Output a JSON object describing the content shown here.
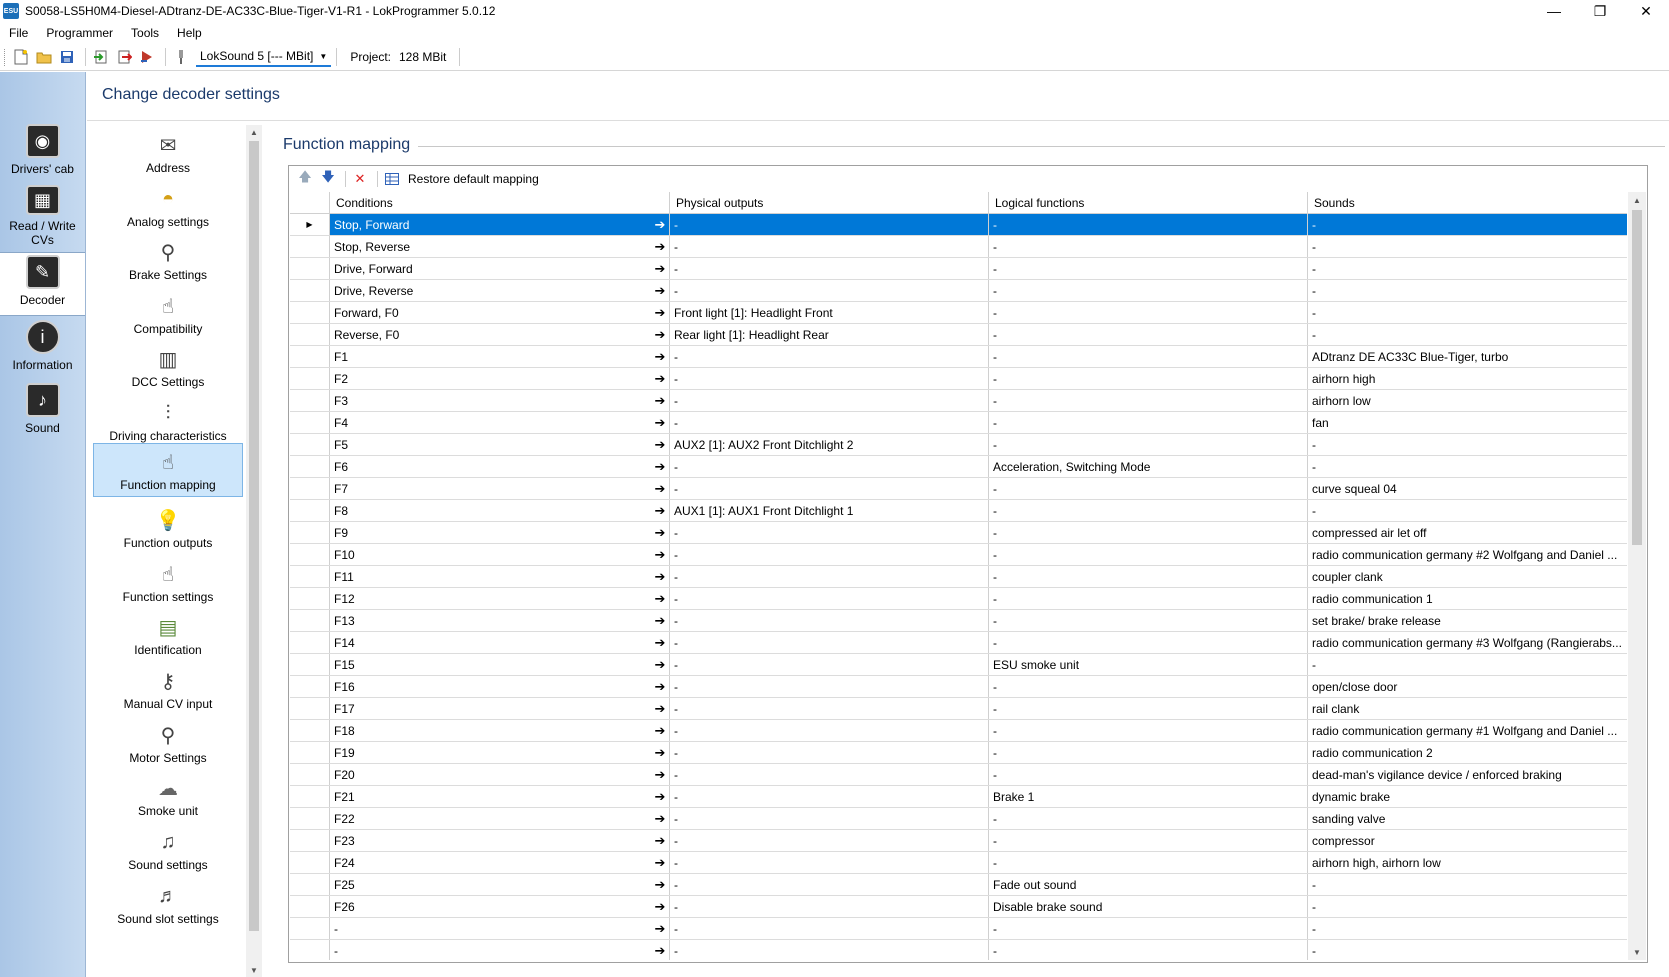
{
  "window": {
    "title": "S0058-LS5H0M4-Diesel-ADtranz-DE-AC33C-Blue-Tiger-V1-R1 - LokProgrammer 5.0.12",
    "app_icon": "ESU",
    "minimize": "—",
    "restore": "❐",
    "close": "✕"
  },
  "menu": [
    "File",
    "Programmer",
    "Tools",
    "Help"
  ],
  "toolbar": {
    "decoder_combo": "LokSound 5 [--- MBit]",
    "project_label": "Project:",
    "project_value": "128 MBit",
    "icons": [
      "new-file-icon",
      "open-folder-icon",
      "save-icon",
      "import-icon",
      "export-icon",
      "play-sound-icon",
      "usb-icon"
    ]
  },
  "rail": [
    {
      "label": "Drivers' cab",
      "icon": "◉"
    },
    {
      "label": "Read / Write CVs",
      "icon": "▦"
    },
    {
      "label": "Decoder",
      "icon": "✎"
    },
    {
      "label": "Information",
      "icon": "i"
    },
    {
      "label": "Sound",
      "icon": "♪"
    }
  ],
  "page_title": "Change decoder settings",
  "categories": [
    {
      "label": "Address",
      "icon": "✉"
    },
    {
      "label": "Analog settings",
      "icon": "◓"
    },
    {
      "label": "Brake Settings",
      "icon": "⚲"
    },
    {
      "label": "Compatibility",
      "icon": "☝"
    },
    {
      "label": "DCC Settings",
      "icon": "▥"
    },
    {
      "label": "Driving characteristics",
      "icon": "⫶"
    },
    {
      "label": "Function mapping",
      "icon": "☝"
    },
    {
      "label": "Function outputs",
      "icon": "💡"
    },
    {
      "label": "Function settings",
      "icon": "☝"
    },
    {
      "label": "Identification",
      "icon": "▤"
    },
    {
      "label": "Manual CV input",
      "icon": "⚷"
    },
    {
      "label": "Motor Settings",
      "icon": "⚲"
    },
    {
      "label": "Smoke unit",
      "icon": "☁"
    },
    {
      "label": "Sound settings",
      "icon": "♫"
    },
    {
      "label": "Sound slot settings",
      "icon": "♬"
    }
  ],
  "section_title": "Function mapping",
  "grid_toolbar": {
    "restore_label": "Restore default mapping"
  },
  "columns": [
    "Conditions",
    "Physical outputs",
    "Logical functions",
    "Sounds"
  ],
  "rows": [
    {
      "cond": "Stop, Forward",
      "phys": "-",
      "log": "-",
      "snd": "-"
    },
    {
      "cond": "Stop, Reverse",
      "phys": "-",
      "log": "-",
      "snd": "-"
    },
    {
      "cond": "Drive, Forward",
      "phys": "-",
      "log": "-",
      "snd": "-"
    },
    {
      "cond": "Drive, Reverse",
      "phys": "-",
      "log": "-",
      "snd": "-"
    },
    {
      "cond": "Forward, F0",
      "phys": "Front light [1]: Headlight Front",
      "log": "-",
      "snd": "-"
    },
    {
      "cond": "Reverse, F0",
      "phys": "Rear light [1]: Headlight Rear",
      "log": "-",
      "snd": "-"
    },
    {
      "cond": "F1",
      "phys": "-",
      "log": "-",
      "snd": "ADtranz DE AC33C Blue-Tiger, turbo"
    },
    {
      "cond": "F2",
      "phys": "-",
      "log": "-",
      "snd": "airhorn high"
    },
    {
      "cond": "F3",
      "phys": "-",
      "log": "-",
      "snd": "airhorn low"
    },
    {
      "cond": "F4",
      "phys": "-",
      "log": "-",
      "snd": "fan"
    },
    {
      "cond": "F5",
      "phys": "AUX2 [1]: AUX2 Front Ditchlight 2",
      "log": "-",
      "snd": "-"
    },
    {
      "cond": "F6",
      "phys": "-",
      "log": "Acceleration, Switching Mode",
      "snd": "-"
    },
    {
      "cond": "F7",
      "phys": "-",
      "log": "-",
      "snd": "curve squeal 04"
    },
    {
      "cond": "F8",
      "phys": "AUX1 [1]: AUX1 Front Ditchlight 1",
      "log": "-",
      "snd": "-"
    },
    {
      "cond": "F9",
      "phys": "-",
      "log": "-",
      "snd": "compressed air let off"
    },
    {
      "cond": "F10",
      "phys": "-",
      "log": "-",
      "snd": "radio communication germany #2 Wolfgang and Daniel ..."
    },
    {
      "cond": "F11",
      "phys": "-",
      "log": "-",
      "snd": "coupler clank"
    },
    {
      "cond": "F12",
      "phys": "-",
      "log": "-",
      "snd": "radio communication 1"
    },
    {
      "cond": "F13",
      "phys": "-",
      "log": "-",
      "snd": "set brake/ brake release"
    },
    {
      "cond": "F14",
      "phys": "-",
      "log": "-",
      "snd": "radio communication germany #3 Wolfgang (Rangierabs..."
    },
    {
      "cond": "F15",
      "phys": "-",
      "log": "ESU smoke unit",
      "snd": "-"
    },
    {
      "cond": "F16",
      "phys": "-",
      "log": "-",
      "snd": "open/close door"
    },
    {
      "cond": "F17",
      "phys": "-",
      "log": "-",
      "snd": "rail clank"
    },
    {
      "cond": "F18",
      "phys": "-",
      "log": "-",
      "snd": "radio communication germany #1 Wolfgang and Daniel ..."
    },
    {
      "cond": "F19",
      "phys": "-",
      "log": "-",
      "snd": "radio communication 2"
    },
    {
      "cond": "F20",
      "phys": "-",
      "log": "-",
      "snd": "dead-man's vigilance device / enforced braking"
    },
    {
      "cond": "F21",
      "phys": "-",
      "log": "Brake 1",
      "snd": "dynamic brake"
    },
    {
      "cond": "F22",
      "phys": "-",
      "log": "-",
      "snd": "sanding valve"
    },
    {
      "cond": "F23",
      "phys": "-",
      "log": "-",
      "snd": "compressor"
    },
    {
      "cond": "F24",
      "phys": "-",
      "log": "-",
      "snd": "airhorn high, airhorn low"
    },
    {
      "cond": "F25",
      "phys": "-",
      "log": "Fade out sound",
      "snd": "-"
    },
    {
      "cond": "F26",
      "phys": "-",
      "log": "Disable brake sound",
      "snd": "-"
    },
    {
      "cond": "-",
      "phys": "-",
      "log": "-",
      "snd": "-"
    },
    {
      "cond": "-",
      "phys": "-",
      "log": "-",
      "snd": "-"
    }
  ],
  "selected_row": 0,
  "selected_category": 6,
  "active_rail": 2
}
